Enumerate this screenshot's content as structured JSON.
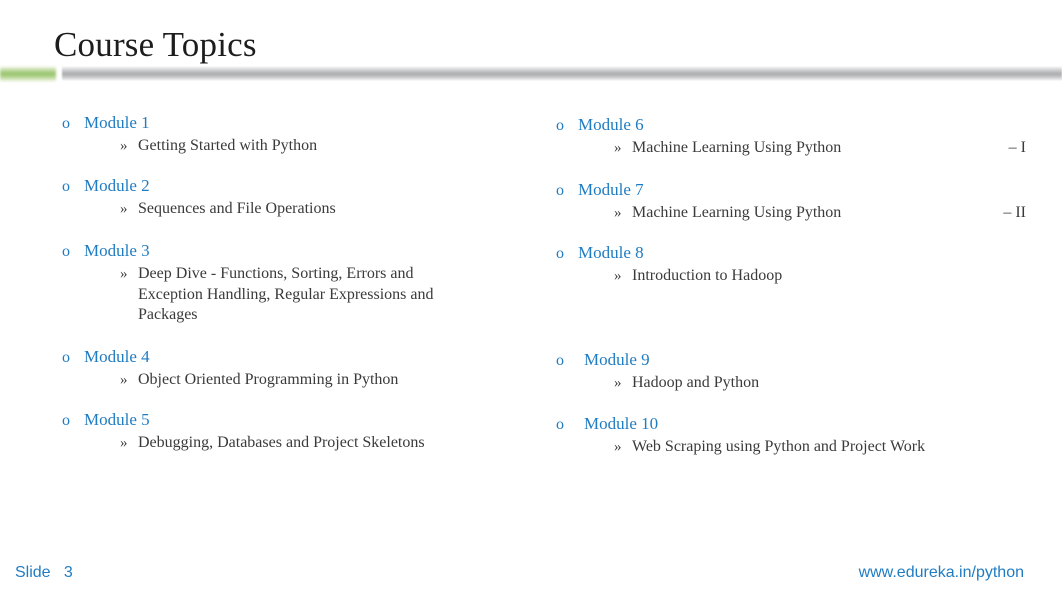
{
  "slide": {
    "title": "Course Topics",
    "accent_green": "#8dbf5e",
    "accent_blue": "#1f7cc2",
    "body_text_color": "#3a3a3a",
    "bullet_marker_level1": "o",
    "bullet_marker_level2": "»"
  },
  "left_column": {
    "modules": [
      {
        "label": "Module 1",
        "marker": "o",
        "topics": [
          {
            "marker": "»",
            "text": "Getting Started with Python",
            "suffix": ""
          }
        ]
      },
      {
        "label": "Module 2",
        "marker": "o",
        "topics": [
          {
            "marker": "»",
            "text": "Sequences and File Operations",
            "suffix": ""
          }
        ]
      },
      {
        "label": "Module 3",
        "marker": "o",
        "topics": [
          {
            "marker": "»",
            "text": "Deep Dive - Functions, Sorting, Errors and Exception Handling, Regular Expressions and Packages",
            "suffix": ""
          }
        ]
      },
      {
        "label": "Module 4",
        "marker": "o",
        "topics": [
          {
            "marker": "»",
            "text": "Object Oriented Programming in Python",
            "suffix": ""
          }
        ]
      },
      {
        "label": "Module 5",
        "marker": "o",
        "topics": [
          {
            "marker": "»",
            "text": "Debugging, Databases and Project Skeletons",
            "suffix": ""
          }
        ]
      }
    ]
  },
  "right_column": {
    "modules": [
      {
        "label": "Module 6",
        "marker": "o",
        "topics": [
          {
            "marker": "»",
            "text": "Machine Learning Using Python",
            "suffix": "– I"
          }
        ]
      },
      {
        "label": "Module 7",
        "marker": "o",
        "topics": [
          {
            "marker": "»",
            "text": "Machine Learning Using Python",
            "suffix": "– II"
          }
        ]
      },
      {
        "label": "Module 8",
        "marker": "o",
        "topics": [
          {
            "marker": "»",
            "text": "Introduction to Hadoop",
            "suffix": ""
          }
        ]
      },
      {
        "label": "Module 9",
        "marker": "o",
        "topics": [
          {
            "marker": "»",
            "text": "Hadoop and Python",
            "suffix": ""
          }
        ]
      },
      {
        "label": "Module 10",
        "marker": "o",
        "topics": [
          {
            "marker": "»",
            "text": "Web Scraping using Python and Project Work",
            "suffix": ""
          }
        ]
      }
    ]
  },
  "footer": {
    "slide_label": "Slide",
    "slide_number": "3",
    "slide_text": "Slide   3",
    "url": "www.edureka.in/python"
  }
}
